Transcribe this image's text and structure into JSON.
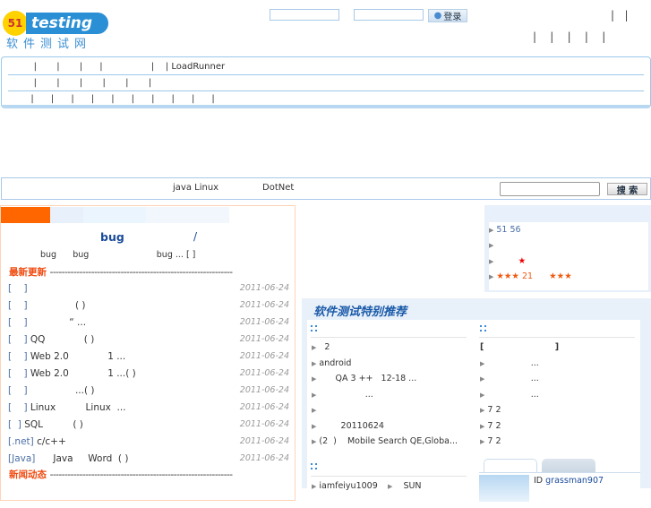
{
  "logo": {
    "badge": "51",
    "brand": "testing",
    "subtitle": "软件测试网"
  },
  "login": {
    "username_value": "",
    "password_value": "",
    "button": "登录"
  },
  "top_links": {
    "row1": "|   |",
    "row2": "|    |    |    |    |"
  },
  "nav": {
    "row1": "         |       |       |      |                 |    | LoadRunner",
    "row2": "         |       |       |       |       |       |",
    "row3": "        |      |      |      |      |      |      |      |      |      |"
  },
  "search": {
    "keywords": [
      "java  Linux",
      "DotNet"
    ],
    "input_value": "",
    "button": "搜 索"
  },
  "feature": {
    "headline": "bug",
    "headline_sep": "/",
    "summary": "bug      bug                         bug ... [ ]"
  },
  "latest": {
    "heading": "最新更新",
    "rows": [
      {
        "cat": "[    ]",
        "title": "",
        "date": "2011-06-24"
      },
      {
        "cat": "[    ]",
        "title": "                ( )",
        "date": "2011-06-24"
      },
      {
        "cat": "[    ]",
        "title": "              “ ...",
        "date": "2011-06-24"
      },
      {
        "cat": "[    ]",
        "title": " QQ             ( )",
        "date": "2011-06-24"
      },
      {
        "cat": "[    ]",
        "title": " Web 2.0             1 ...",
        "date": "2011-06-24"
      },
      {
        "cat": "[    ]",
        "title": " Web 2.0             1 ...( )",
        "date": "2011-06-24"
      },
      {
        "cat": "[    ]",
        "title": "                ...( )",
        "date": "2011-06-24"
      },
      {
        "cat": "[    ]",
        "title": " Linux          Linux  ...",
        "date": "2011-06-24"
      },
      {
        "cat": "[  ]",
        "title": " SQL          ( )",
        "date": "2011-06-24"
      },
      {
        "cat": "[.net]",
        "title": " c/c++",
        "date": "2011-06-24"
      },
      {
        "cat": "[Java]",
        "title": "      Java     Word  ( )",
        "date": "2011-06-24"
      }
    ]
  },
  "news": {
    "heading": "新闻动态"
  },
  "right_box": {
    "items": [
      "51 56",
      "",
      "★",
      "★★★ 21      ★★★"
    ]
  },
  "recommend": {
    "title": "软件测试特别推荐",
    "left_items": [
      "  2",
      "android",
      "      QA 3 ++   12-18 ...",
      "                 ...",
      "",
      "        20110624",
      "(2  )    Mobile Search QE,Globa..."
    ],
    "right_items": [
      "[                        ]",
      "                ...",
      "                ...",
      "                ...",
      "7 2",
      "7 2",
      "7 2"
    ],
    "left2_items": [
      "iamfeiyu1009",
      "SUN"
    ],
    "member": {
      "id_label": "ID",
      "id": "grassman907"
    }
  }
}
